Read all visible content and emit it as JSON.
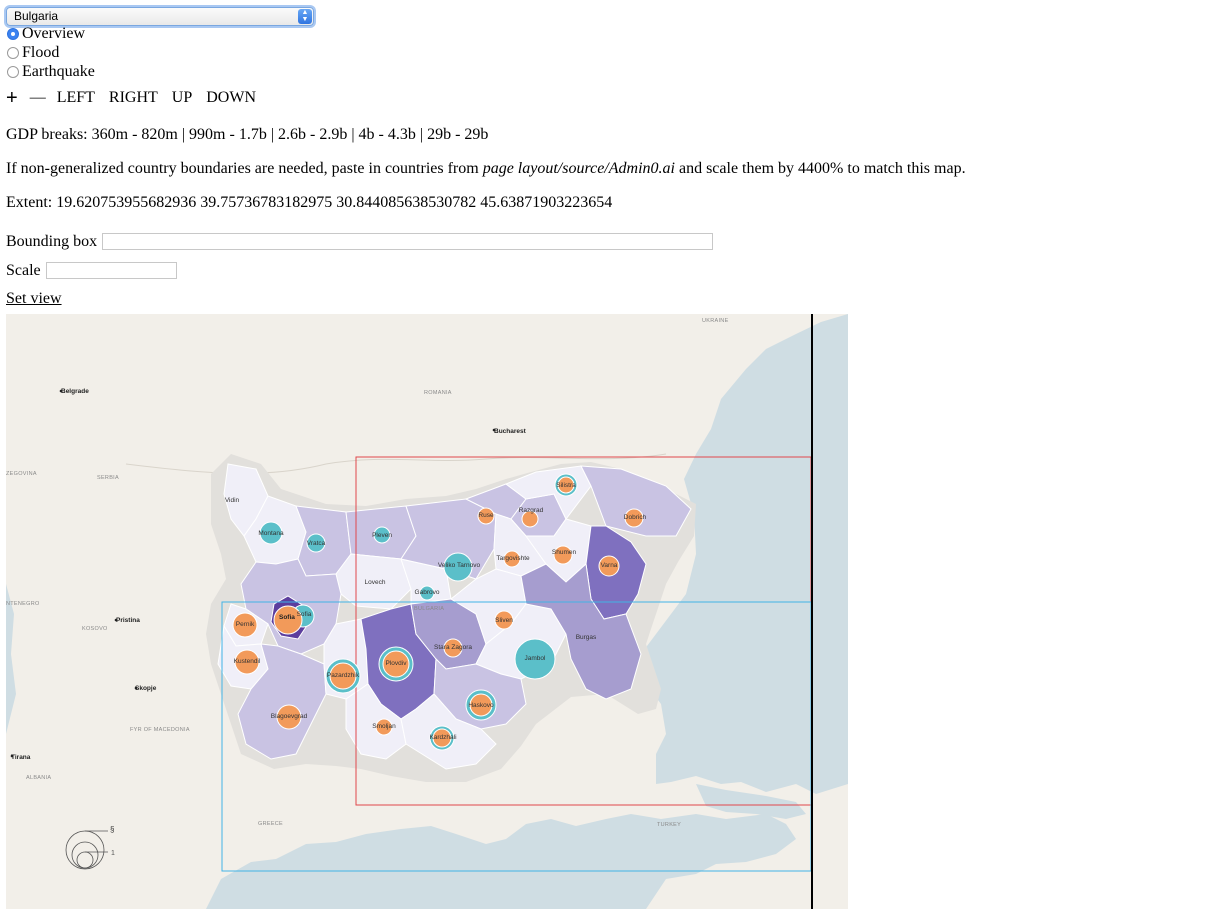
{
  "country_select": {
    "value": "Bulgaria",
    "arrow_icon": "select-arrows-icon"
  },
  "modes": [
    {
      "label": "Overview",
      "checked": true
    },
    {
      "label": "Flood",
      "checked": false
    },
    {
      "label": "Earthquake",
      "checked": false
    }
  ],
  "nav": {
    "zoom_in": "+",
    "zoom_out": "—",
    "left": "LEFT",
    "right": "RIGHT",
    "up": "UP",
    "down": "DOWN"
  },
  "gdp_breaks": "GDP breaks: 360m - 820m | 990m - 1.7b | 2.6b - 2.9b | 4b - 4.3b | 29b - 29b",
  "note": {
    "before": "If non-generalized country boundaries are needed, paste in countries from ",
    "path": "page layout/source/Admin0.ai",
    "after": " and scale them by 4400% to match this map."
  },
  "extent": "Extent: 19.620753955682936 39.75736783182975 30.844085638530782 45.63871903223654",
  "bounding_box": {
    "label": "Bounding box",
    "value": ""
  },
  "scale": {
    "label": "Scale",
    "value": ""
  },
  "set_view": "Set view",
  "map": {
    "colors": {
      "water": "#cfdde3",
      "land": "#f2efe9",
      "halo": "#e2e0dc",
      "region_1": "#f0eff8",
      "region_2": "#c9c3e3",
      "region_3": "#a69dcf",
      "region_4": "#7f70bf",
      "region_5": "#5c3e9e",
      "orange": "#f29a5a",
      "teal": "#5bbfc9",
      "red_box": "#e0474c",
      "blue_box": "#41b3e6"
    },
    "cities": [
      "Belgrade",
      "Bucharest",
      "Pristina",
      "Skopje",
      "Tirana",
      "Sofia"
    ],
    "countries": [
      "ROMANIA",
      "SERBIA",
      "KOSOVO",
      "FYR OF MACEDONIA",
      "ALBANIA",
      "GREECE",
      "TURKEY",
      "UKRAINE",
      "BULGARIA",
      "ZEGOVINA",
      "NTENEGRO"
    ],
    "regions": [
      "Vidin",
      "Montana",
      "Vratca",
      "Pleven",
      "Veliko Tarnovo",
      "Ruse",
      "Razgrad",
      "Silistra",
      "Dobrich",
      "Targovishte",
      "Shumen",
      "Varna",
      "Lovech",
      "Gabrovo",
      "Sofia",
      "Pernik",
      "Kustendil",
      "Pazardzhik",
      "Blagoevgrad",
      "Plovdiv",
      "Stara Zagora",
      "Sliven",
      "Jambol",
      "Burgas",
      "Haskovo",
      "Smoljan",
      "Kardzhali"
    ],
    "legend": {
      "top": "§",
      "bottom": "1"
    }
  }
}
